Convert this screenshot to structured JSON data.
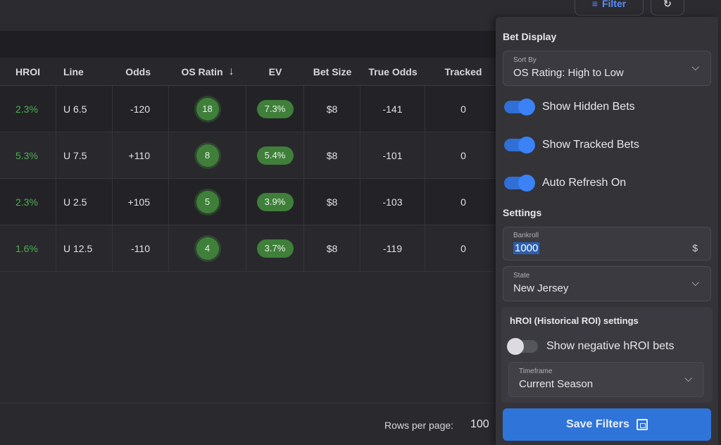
{
  "toolbar": {
    "filter_label": "Filter",
    "filter_icon": "≡",
    "refresh_icon": "↻"
  },
  "table": {
    "headers": {
      "hroi": "HROI",
      "line": "Line",
      "odds": "Odds",
      "os_rating": "OS Ratin",
      "ev": "EV",
      "bet_size": "Bet Size",
      "true_odds": "True Odds",
      "tracked": "Tracked"
    },
    "sort_icon": "↓",
    "rows": [
      {
        "hroi": "2.3%",
        "line": "U 6.5",
        "odds": "-120",
        "os_rating": "18",
        "ev": "7.3%",
        "bet_size": "$8",
        "true_odds": "-141",
        "tracked": "0"
      },
      {
        "hroi": "5.3%",
        "line": "U 7.5",
        "odds": "+110",
        "os_rating": "8",
        "ev": "5.4%",
        "bet_size": "$8",
        "true_odds": "-101",
        "tracked": "0"
      },
      {
        "hroi": "2.3%",
        "line": "U 2.5",
        "odds": "+105",
        "os_rating": "5",
        "ev": "3.9%",
        "bet_size": "$8",
        "true_odds": "-103",
        "tracked": "0"
      },
      {
        "hroi": "1.6%",
        "line": "U 12.5",
        "odds": "-110",
        "os_rating": "4",
        "ev": "3.7%",
        "bet_size": "$8",
        "true_odds": "-119",
        "tracked": "0"
      }
    ]
  },
  "footer": {
    "rows_per_page_label": "Rows per page:",
    "rows_per_page_value": "100"
  },
  "panel": {
    "bet_display_title": "Bet Display",
    "sort_by": {
      "label": "Sort By",
      "value": "OS Rating: High to Low"
    },
    "toggles": [
      {
        "label": "Show Hidden Bets",
        "on": true
      },
      {
        "label": "Show Tracked Bets",
        "on": true
      },
      {
        "label": "Auto Refresh On",
        "on": true
      }
    ],
    "settings_title": "Settings",
    "bankroll": {
      "label": "Bankroll",
      "value": "1000",
      "unit": "$"
    },
    "state": {
      "label": "State",
      "value": "New Jersey"
    },
    "hroi_settings": {
      "title": "hROI (Historical ROI) settings",
      "negative_toggle": {
        "label": "Show negative hROI bets",
        "on": false
      },
      "timeframe": {
        "label": "Timeframe",
        "value": "Current Season"
      }
    },
    "save_label": "Save Filters"
  },
  "colors": {
    "accent_blue": "#2f74d8",
    "positive_green": "#4caf50",
    "pill_green": "#3f7f3a",
    "panel_bg": "#333338"
  }
}
